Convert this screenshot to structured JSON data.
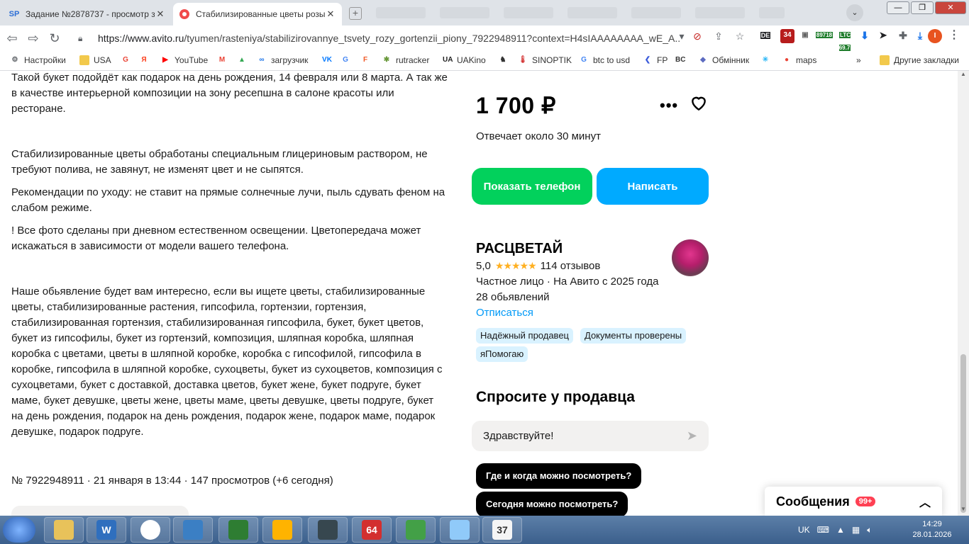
{
  "browser": {
    "tabs": [
      {
        "label": "Задание №2878737 - просмотр з",
        "icon": "sp-icon"
      },
      {
        "label": "Стабилизированные цветы розы",
        "icon": "avito-icon"
      }
    ],
    "url_prefix": "https://www.avito.ru",
    "url_rest": "/tyumen/rasteniya/stabilizirovannye_tsvety_rozy_gortenzii_piony_7922948911?context=H4sIAAAAAAAA_wE_A...",
    "extensions": [
      {
        "name": "DE",
        "color": "#1a73e8"
      },
      {
        "name": "34",
        "color": "#b71c1c"
      },
      {
        "name": "89718",
        "color": "#1f7d2c"
      },
      {
        "name": "LTC 69.7",
        "color": "#1f7d2c"
      }
    ],
    "profile_initial": "I"
  },
  "bookmarks": [
    {
      "label": "Настройки",
      "icon": "gear-icon",
      "color": "#5f6368"
    },
    {
      "label": "USA",
      "icon": "folder-icon",
      "color": "#f2c94c"
    },
    {
      "label": "",
      "icon": "google-icon",
      "color": "#ea4335"
    },
    {
      "label": "",
      "icon": "yandex-icon",
      "color": "#fc3f1d"
    },
    {
      "label": "YouTube",
      "icon": "youtube-icon",
      "color": "#ff0000"
    },
    {
      "label": "",
      "icon": "gmail-icon",
      "color": "#ea4335"
    },
    {
      "label": "",
      "icon": "drive-icon",
      "color": "#34a853"
    },
    {
      "label": "загрузчик",
      "icon": "loader-icon",
      "color": "#1a73e8"
    },
    {
      "label": "",
      "icon": "vk-icon",
      "color": "#0077ff"
    },
    {
      "label": "",
      "icon": "translate-icon",
      "color": "#4285f4"
    },
    {
      "label": "",
      "icon": "f-icon",
      "color": "#f05a28"
    },
    {
      "label": "rutracker",
      "icon": "rutracker-icon",
      "color": "#6a9a3c"
    },
    {
      "label": "UAKino",
      "icon": "uakino-icon",
      "color": "#222222"
    },
    {
      "label": "",
      "icon": "figure-icon",
      "color": "#333333"
    },
    {
      "label": "SINOPTIK",
      "icon": "thermometer-icon",
      "color": "#d32f2f"
    },
    {
      "label": "btc to usd",
      "icon": "google-icon",
      "color": "#4285f4"
    },
    {
      "label": "FP",
      "icon": "fp-icon",
      "color": "#3b5bdb"
    },
    {
      "label": "",
      "icon": "bc-icon",
      "color": "#333333"
    },
    {
      "label": "Обмінник",
      "icon": "exchange-icon",
      "color": "#5c6bc0"
    },
    {
      "label": "",
      "icon": "snowflake-icon",
      "color": "#29b6f6"
    },
    {
      "label": "maps",
      "icon": "maps-icon",
      "color": "#ea4335"
    }
  ],
  "bookmarks_overflow": "»",
  "bookmarks_other": "Другие закладки",
  "description": {
    "p1": "Такой букет подойдёт как подарок на день рождения, 14 февраля или 8 марта. А так же в качестве интерьерной композиции на зону ресепшна в салоне красоты или ресторане.",
    "p2": "Стабилизированные цветы обработаны специальным глицериновым раствором, не требуют полива, не завянут, не изменят цвет и не сыпятся.",
    "p3": "Рекомендации по уходу: не ставит на прямые солнечные лучи, пыль сдувать феном на слабом режиме.",
    "p4": "! Все фото сделаны при дневном естественном освещении. Цветопередача может искажаться в зависимости от модели вашего телефона.",
    "p5": "Наше обьявление будет вам интересно, если вы ищете цветы, стабилизированные цветы, стабилизированные растения, гипсофила, гортензии, гортензия, стабилизированная гортензия, стабилизированная гипсофила, букет, букет цветов, букет из гипсофилы, букет из гортензий, композиция, шляпная коробка, шляпная коробка с цветами, цветы в шляпной коробке, коробка с гипсофилой, гипсофила в коробке, гипсофила в шляпной коробке, сухоцветы, букет из сухоцветов, композиция с сухоцветами, букет с доставкой, доставка цветов, букет жене, букет подруге, букет маме, букет девушке, цветы жене, цветы маме, цветы девушке, цветы подруге, букет на день рождения, подарок на день рождения, подарок жене, подарок маме, подарок девушке, подарок подруге."
  },
  "meta": "№ 7922948911 · 21 января в 13:44 · 147 просмотров (+6 сегодня)",
  "sidebar": {
    "price": "1 700 ₽",
    "more": "•••",
    "reply_time": "Отвечает около 30 минут",
    "show_phone": "Показать телефон",
    "write": "Написать",
    "seller": {
      "name": "РАСЦВЕТАЙ",
      "rating": "5,0",
      "stars": "★★★★★",
      "reviews": "114 отзывов",
      "type": "Частное лицо · На Авито с 2025 года",
      "ads": "28 обьявлений",
      "unsubscribe": "Отписаться",
      "badges": [
        "Надёжный продавец",
        "Документы проверены",
        "яПомогаю"
      ]
    },
    "ask_title": "Спросите у продавца",
    "message_placeholder": "Здравствуйте!",
    "quick_questions": [
      "Где и когда можно посмотреть?",
      "Сегодня можно посмотреть?"
    ]
  },
  "messages": {
    "title": "Сообщения",
    "count": "99+"
  },
  "taskbar": {
    "lang": "UK",
    "time": "14:29",
    "date": "28.01.2026",
    "apps": [
      {
        "name": "explorer",
        "label": ""
      },
      {
        "name": "wiseguard",
        "label": "W"
      },
      {
        "name": "chrome",
        "label": ""
      },
      {
        "name": "browser-globe",
        "label": ""
      },
      {
        "name": "excel",
        "label": ""
      },
      {
        "name": "media",
        "label": ""
      },
      {
        "name": "clock-app",
        "label": ""
      },
      {
        "name": "aida64",
        "label": "64"
      },
      {
        "name": "paint",
        "label": ""
      },
      {
        "name": "notes",
        "label": ""
      },
      {
        "name": "calendar",
        "label": "37"
      }
    ]
  }
}
